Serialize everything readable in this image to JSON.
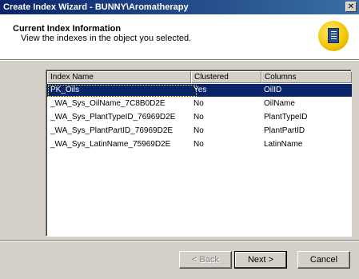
{
  "window": {
    "title": "Create Index Wizard - BUNNY\\Aromatherapy",
    "close_glyph": "✕"
  },
  "header": {
    "title": "Current Index Information",
    "subtitle": "View the indexes in the object you selected.",
    "icon": "wizard-index-icon"
  },
  "table": {
    "columns": [
      "Index Name",
      "Clustered",
      "Columns"
    ],
    "rows": [
      {
        "name": "PK_Oils",
        "clustered": "Yes",
        "columns": "OilID",
        "selected": true
      },
      {
        "name": "_WA_Sys_OilName_7C8B0D2E",
        "clustered": "No",
        "columns": "OilName",
        "selected": false
      },
      {
        "name": "_WA_Sys_PlantTypeID_76969D2E",
        "clustered": "No",
        "columns": "PlantTypeID",
        "selected": false
      },
      {
        "name": "_WA_Sys_PlantPartID_76969D2E",
        "clustered": "No",
        "columns": "PlantPartID",
        "selected": false
      },
      {
        "name": "_WA_Sys_LatinName_75969D2E",
        "clustered": "No",
        "columns": "LatinName",
        "selected": false
      }
    ]
  },
  "buttons": {
    "back": "< Back",
    "next": "Next >",
    "cancel": "Cancel"
  },
  "colors": {
    "titlebar": "#0a246a",
    "selection": "#0a246a",
    "face": "#d4d0c8",
    "icon": "#f2c300"
  }
}
